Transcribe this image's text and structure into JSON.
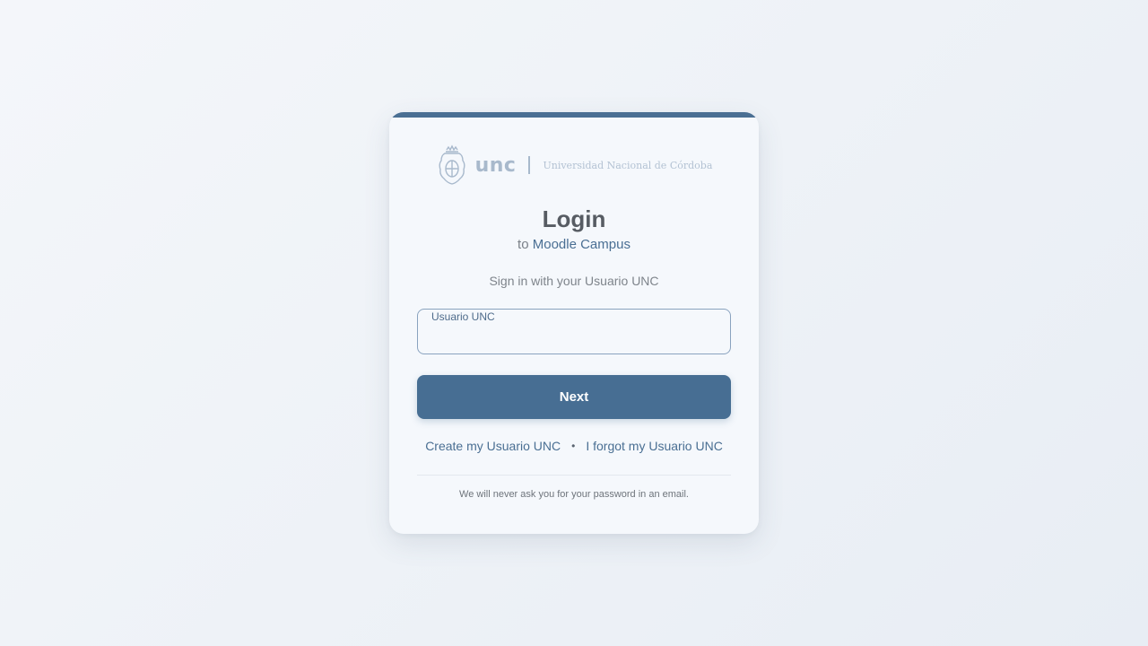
{
  "brand": {
    "crest_icon": "unc-crest-icon",
    "abbr": "unc",
    "name": "Universidad Nacional de Córdoba"
  },
  "login": {
    "title": "Login",
    "subtitle_prefix": "to",
    "app_name": "Moodle Campus",
    "instruction": "Sign in with your Usuario UNC"
  },
  "form": {
    "username_label": "Usuario UNC",
    "username_value": "",
    "next_label": "Next"
  },
  "links": {
    "create": "Create my Usuario UNC",
    "separator": "•",
    "forgot": "I forgot my Usuario UNC"
  },
  "footer": {
    "notice": "We will never ask you for your password in an email."
  },
  "colors": {
    "accent": "#476e93",
    "background": "#eef2f7",
    "card": "#f5f8fc",
    "brand_muted": "#a8b9cc"
  }
}
